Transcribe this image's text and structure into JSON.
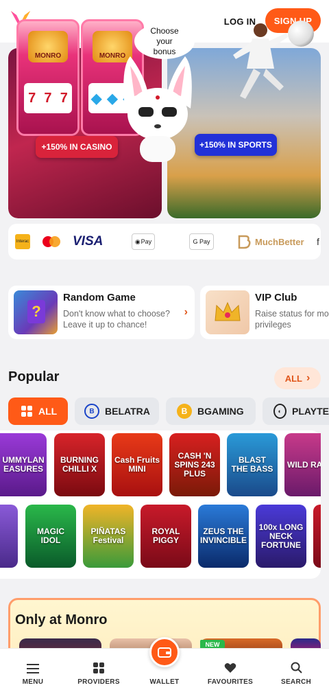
{
  "header": {
    "login_label": "LOG IN",
    "signup_label": "SIGN UP"
  },
  "banner": {
    "bubble_line1": "Choose",
    "bubble_line2": "your",
    "bubble_line3": "bonus",
    "casino_badge": "+150% IN CASINO",
    "sports_badge": "+150% IN SPORTS",
    "slot_brand": "MONRO"
  },
  "payments": {
    "visa": "VISA",
    "applepay": "Pay",
    "googlepay": "G Pay",
    "muchbetter": "MuchBetter"
  },
  "quick_links": [
    {
      "title": "Random Game",
      "desc_line1": "Don't know what to choose?",
      "desc_line2": "Leave it up to chance!"
    },
    {
      "title": "VIP Club",
      "desc_line1": "Raise status for mo",
      "desc_line2": "privileges"
    }
  ],
  "popular": {
    "title": "Popular",
    "all_link": "ALL"
  },
  "filters": [
    {
      "label": "ALL"
    },
    {
      "label": "BELATRA"
    },
    {
      "label": "BGAMING"
    },
    {
      "label": "PLAYTE"
    }
  ],
  "games_row1": [
    {
      "title": "UMMYLAN EASURES"
    },
    {
      "title": "BURNING CHILLI X"
    },
    {
      "title": "Cash Fruits MINI"
    },
    {
      "title": "CASH 'N SPINS 243 PLUS"
    },
    {
      "title": "BLAST THE BASS"
    },
    {
      "title": "WILD RABBIT"
    }
  ],
  "games_row2": [
    {
      "title": "MAGIC IDOL"
    },
    {
      "title": "PIÑATAS Festival"
    },
    {
      "title": "ROYAL PIGGY"
    },
    {
      "title": "ZEUS THE INVINCIBLE"
    },
    {
      "title": "100x LONG NECK FORTUNE"
    }
  ],
  "only_at": {
    "title": "Only at Monro",
    "new_badge": "NEW"
  },
  "bottom_nav": {
    "menu": "MENU",
    "providers": "PROVIDERS",
    "wallet": "WALLET",
    "favourites": "FAVOURITES",
    "search": "SEARCH"
  },
  "colors": {
    "accent": "#ff5a17",
    "casino_badge": "#d9233b",
    "sports_badge": "#2231d8"
  }
}
